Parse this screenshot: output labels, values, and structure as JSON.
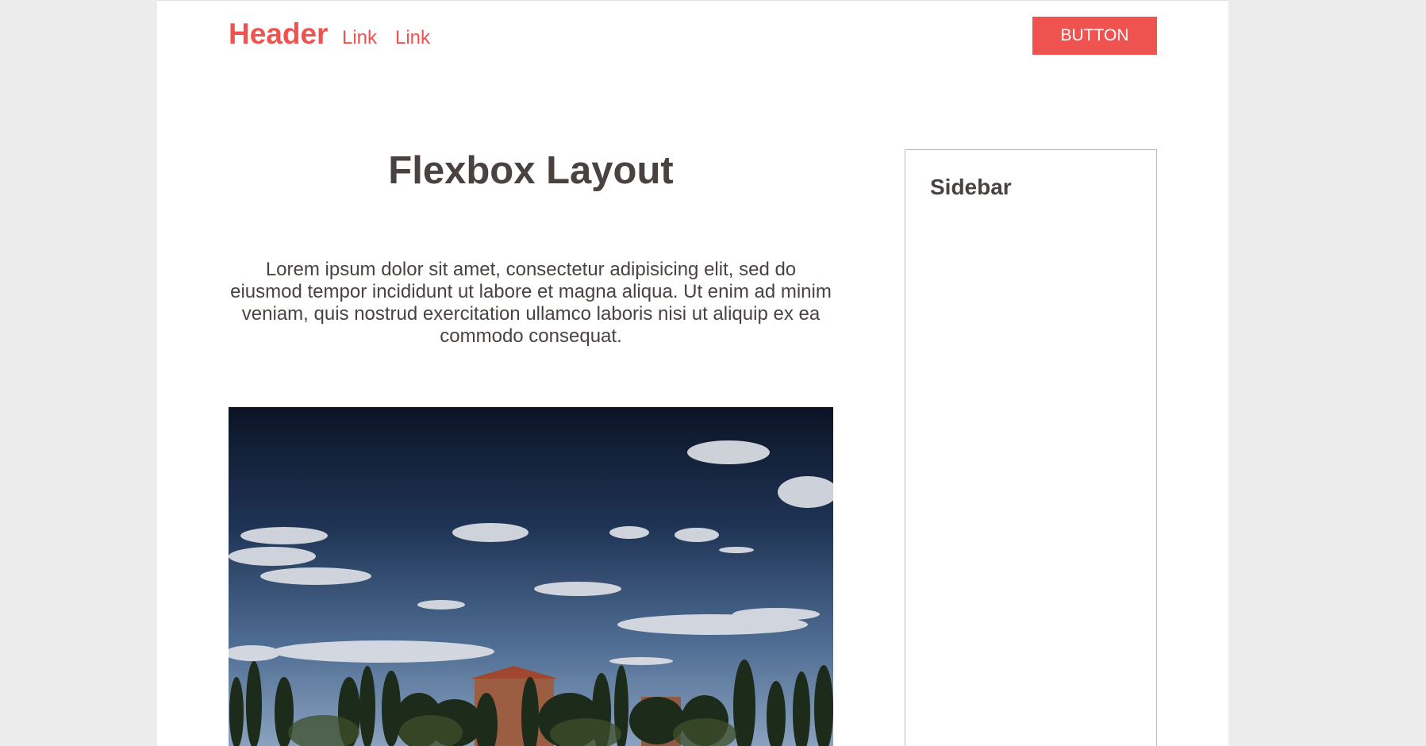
{
  "header": {
    "title": "Header",
    "links": [
      "Link",
      "Link"
    ],
    "button_label": "BUTTON"
  },
  "main": {
    "title": "Flexbox Layout",
    "paragraph": "Lorem ipsum dolor sit amet, consectetur adipisicing elit, sed do eiusmod tempor incididunt ut labore et magna aliqua. Ut enim ad minim veniam, quis nostrud exercitation ullamco laboris nisi ut aliquip ex ea commodo consequat."
  },
  "sidebar": {
    "title": "Sidebar"
  },
  "colors": {
    "accent": "#ef5350",
    "text": "#4a4241",
    "background": "#ececec",
    "page": "#ffffff"
  }
}
